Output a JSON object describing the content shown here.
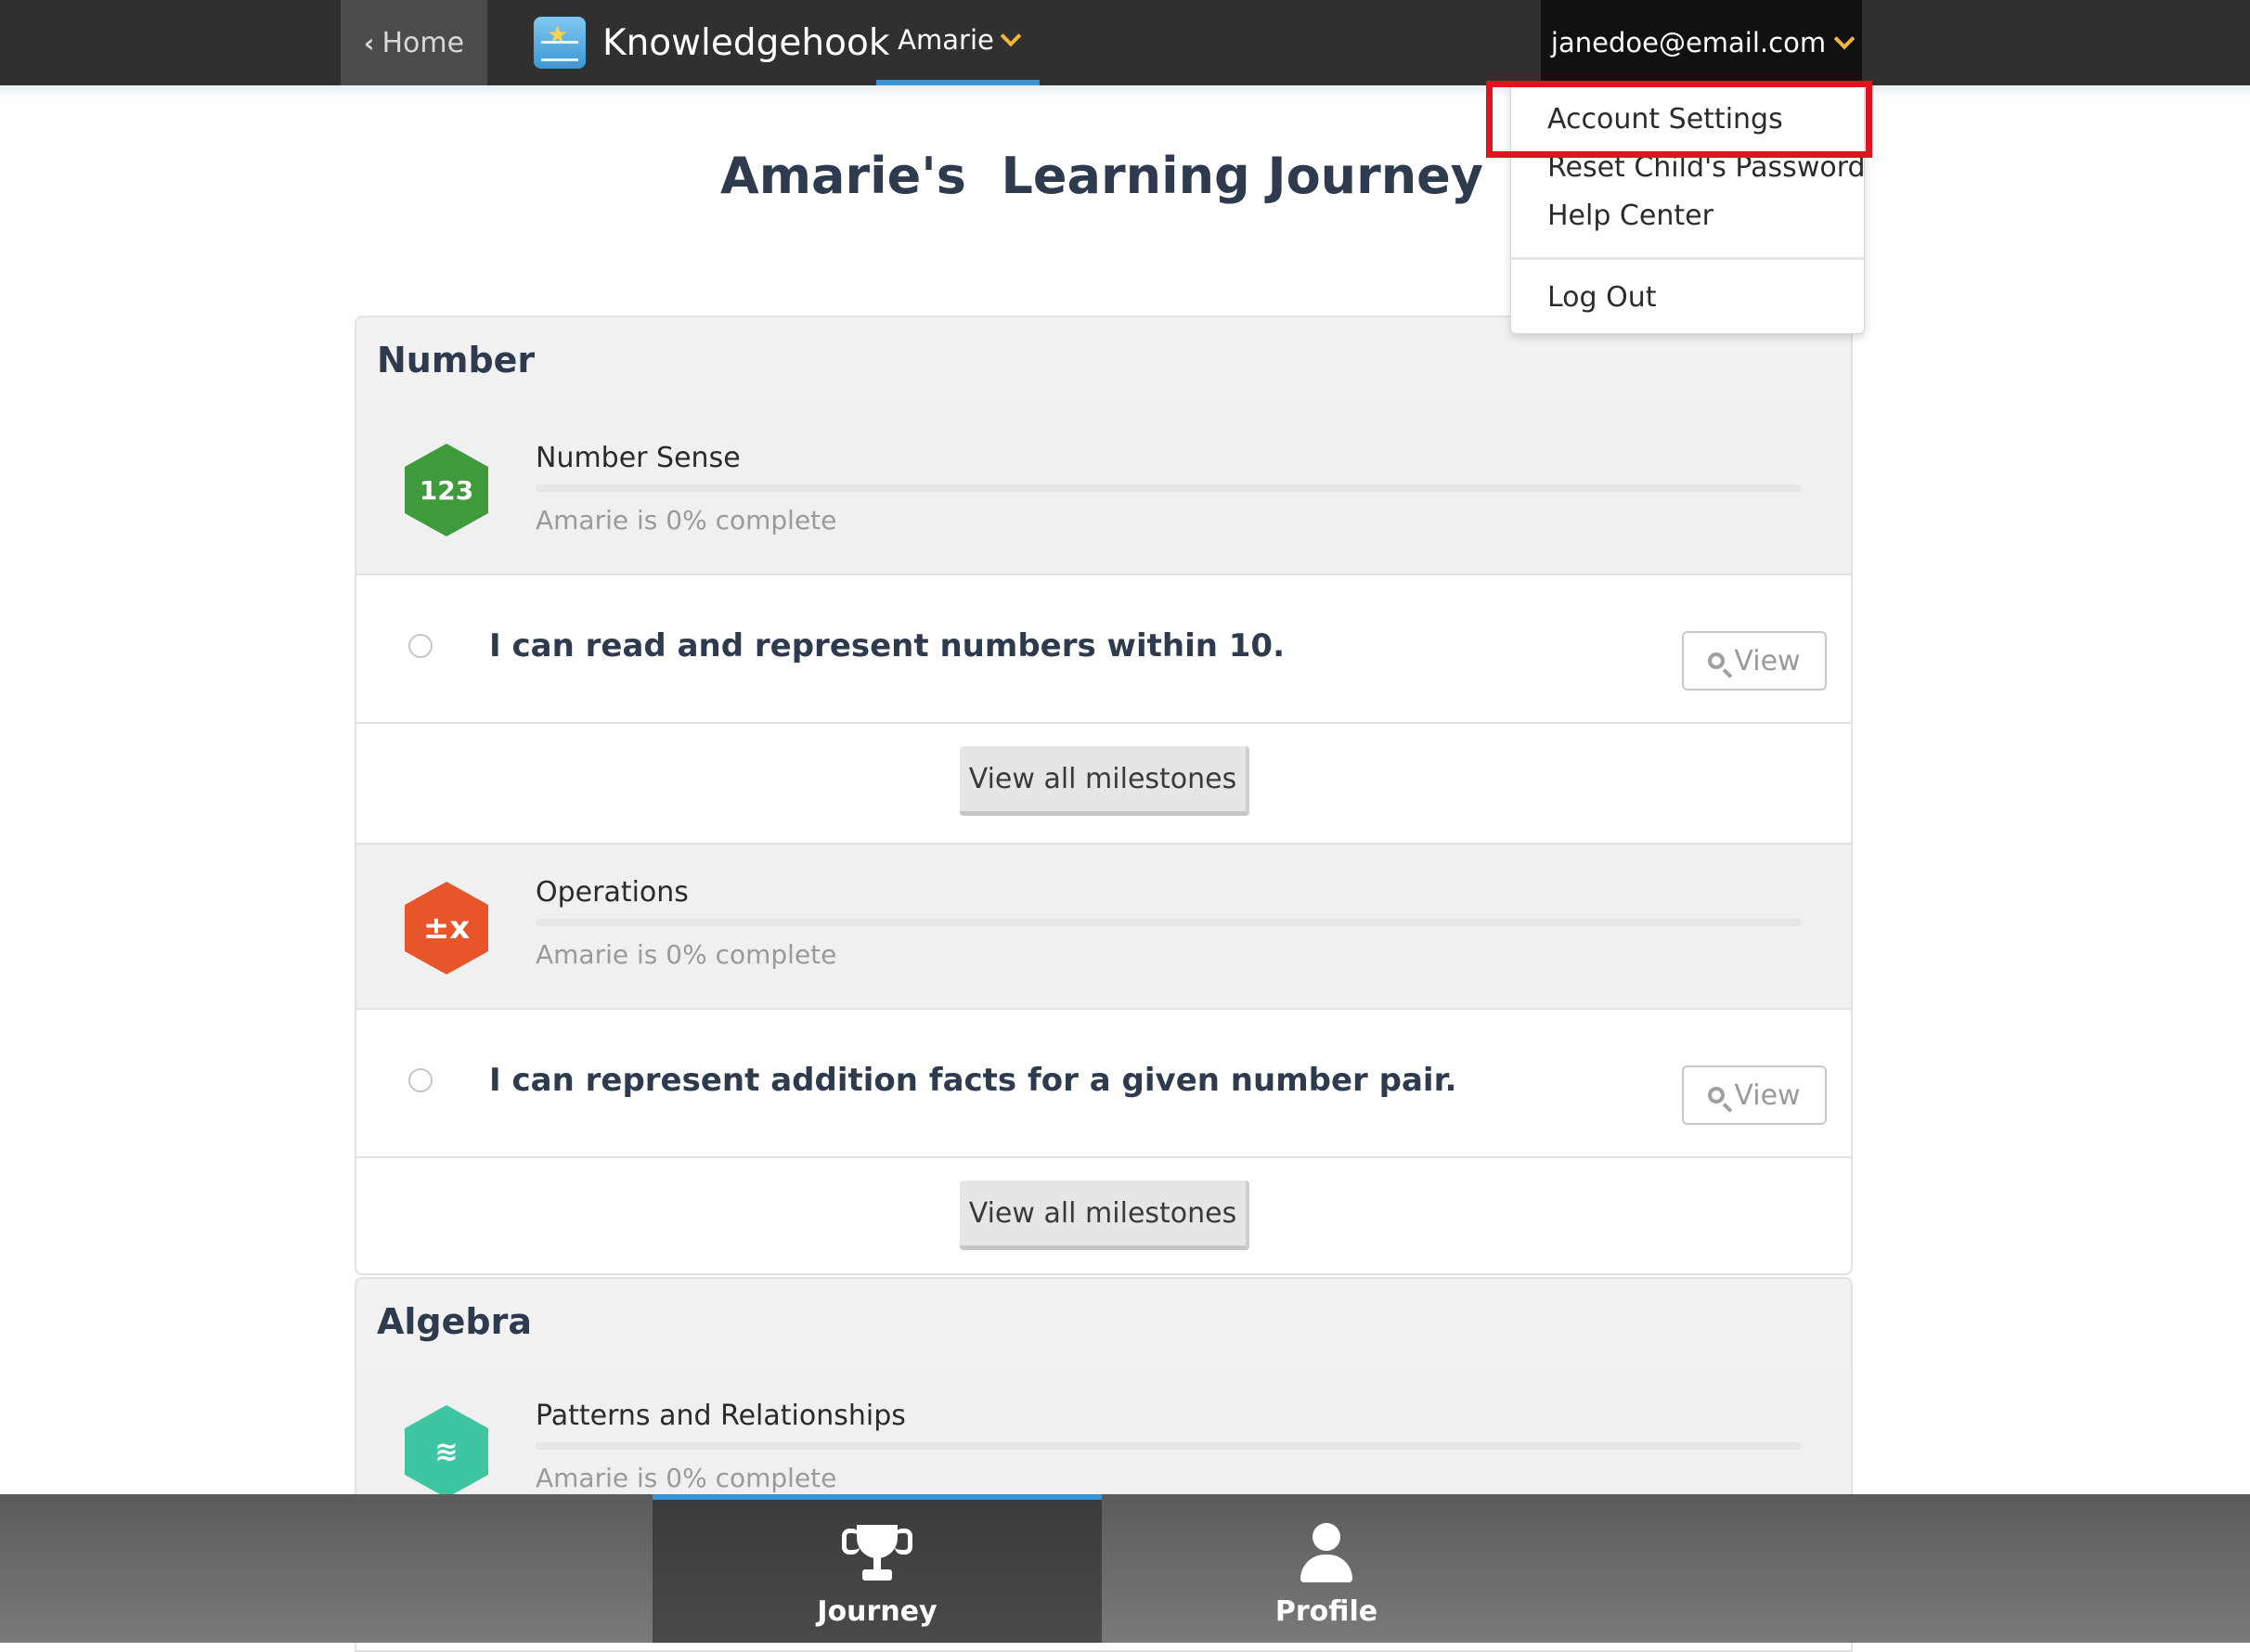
{
  "nav": {
    "home_label": "Home",
    "brand": "Knowledgehook",
    "child_name": "Amarie",
    "account_email": "janedoe@email.com"
  },
  "account_menu": {
    "items": [
      "Account Settings",
      "Reset Child's Password",
      "Help Center"
    ],
    "logout": "Log Out",
    "highlighted": "Account Settings",
    "highlight_color": "#e0141e"
  },
  "page": {
    "title": "Amarie's  Learning Journey"
  },
  "sections": [
    {
      "heading": "Number",
      "strands": [
        {
          "title": "Number Sense",
          "icon": "123-hex-icon",
          "icon_text": "123",
          "icon_color": "#3e9a3a",
          "progress_text": "Amarie is 0% complete",
          "progress": 0,
          "milestone": "I can read and represent numbers within 10.",
          "view_label": "View",
          "view_all_label": "View all milestones"
        },
        {
          "title": "Operations",
          "icon": "operations-hex-icon",
          "icon_text": "±x",
          "icon_color": "#e8552a",
          "progress_text": "Amarie is 0% complete",
          "progress": 0,
          "milestone": "I can represent addition facts for a given number pair.",
          "view_label": "View",
          "view_all_label": "View all milestones"
        }
      ]
    },
    {
      "heading": "Algebra",
      "strands": [
        {
          "title": "Patterns and Relationships",
          "icon": "patterns-hex-icon",
          "icon_text": "≋",
          "icon_color": "#3ec6a2",
          "progress_text": "Amarie is 0% complete",
          "progress": 0
        }
      ]
    }
  ],
  "bottom_nav": {
    "journey_label": "Journey",
    "profile_label": "Profile",
    "active": "Journey"
  },
  "colors": {
    "accent": "#3a93d6",
    "caret": "#f0b53a",
    "topbar": "#303030"
  }
}
